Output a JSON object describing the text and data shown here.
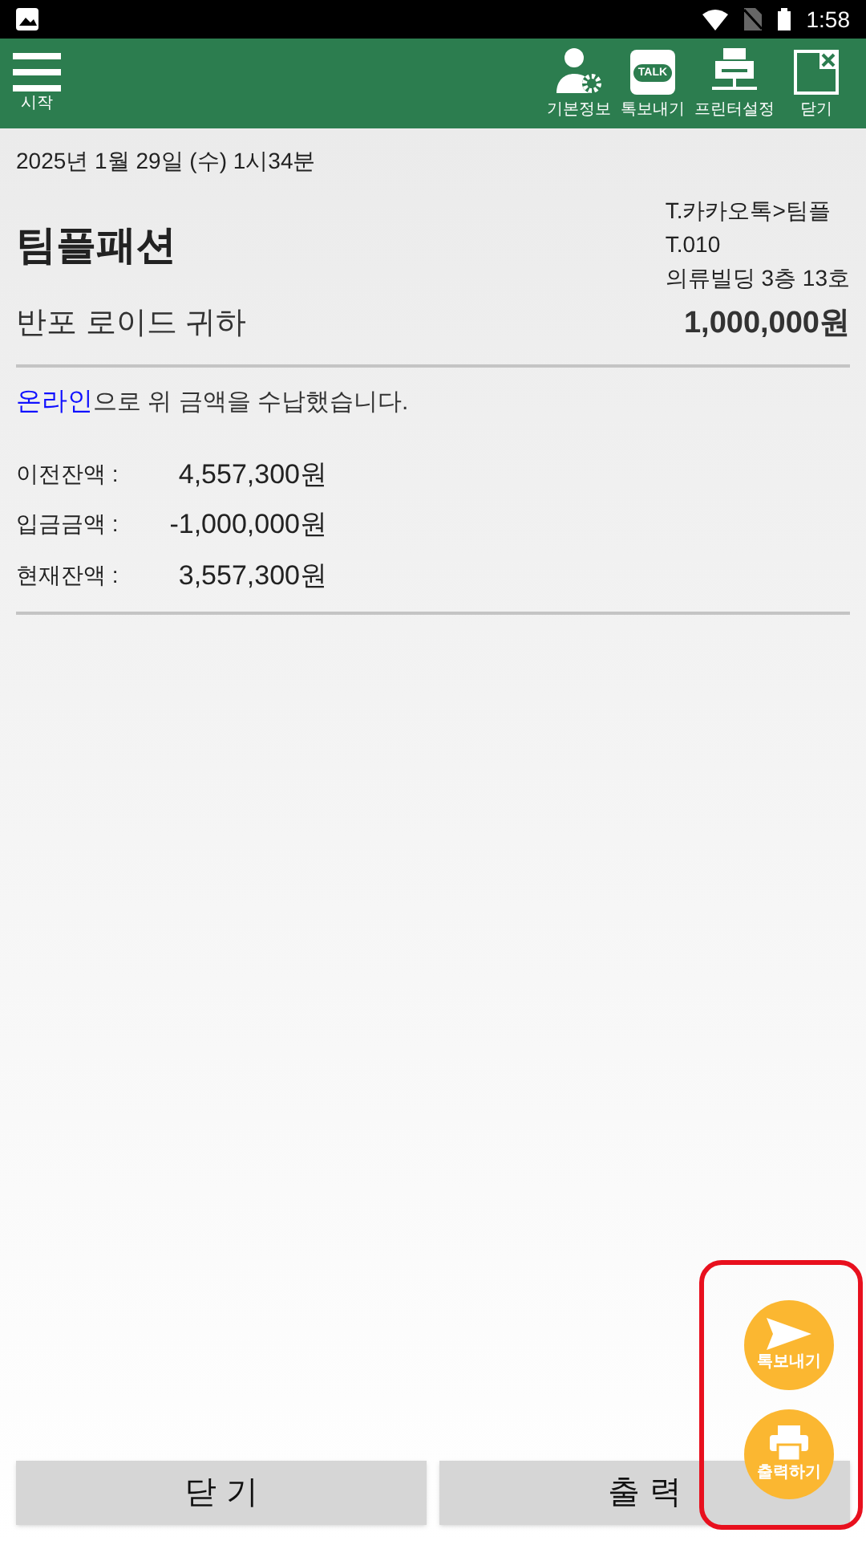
{
  "status_bar": {
    "time": "1:58"
  },
  "toolbar": {
    "menu": {
      "label": "시작"
    },
    "actions": [
      {
        "kind": "profile",
        "label": "기본정보"
      },
      {
        "kind": "talk",
        "label": "톡보내기",
        "icon_text": "TALK"
      },
      {
        "kind": "printer",
        "label": "프린터설정"
      },
      {
        "kind": "close",
        "label": "닫기"
      }
    ]
  },
  "receipt": {
    "date": "2025년 1월 29일 (수) 1시34분",
    "shop": "팀플패션",
    "contact": [
      "T.카카오톡>팀플",
      "T.010",
      "의류빌딩 3층 13호"
    ],
    "customer": "반포 로이드 귀하",
    "amount": "1,000,000원",
    "method": "온라인",
    "message": "으로 위 금액을 수납했습니다.",
    "balances": [
      {
        "label": "이전잔액 :",
        "value": "4,557,300원"
      },
      {
        "label": "입금금액 :",
        "value": "-1,000,000원"
      },
      {
        "label": "현재잔액 :",
        "value": "3,557,300원"
      }
    ]
  },
  "buttons": [
    "닫 기",
    "출 력"
  ],
  "fabs": [
    {
      "kind": "send",
      "label": "톡보내기"
    },
    {
      "kind": "print",
      "label": "출력하기"
    }
  ]
}
